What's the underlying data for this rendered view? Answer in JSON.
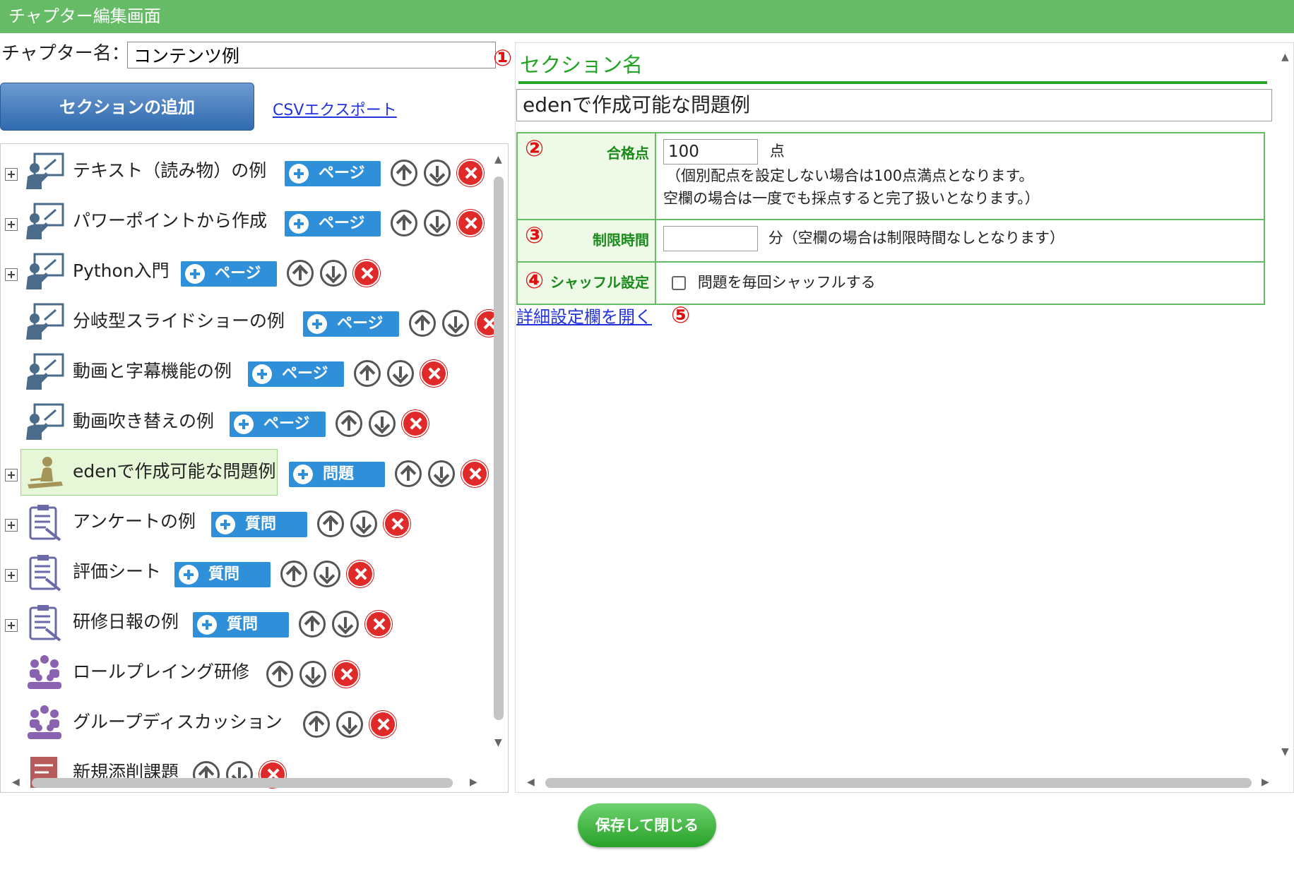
{
  "window": {
    "title": "チャプター編集画面"
  },
  "chapter": {
    "label": "チャプター名：",
    "name_value": "コンテンツ例"
  },
  "toolbar": {
    "add_section": "セクションの追加",
    "csv_export": "CSVエクスポート"
  },
  "tree": {
    "items": [
      {
        "label": "テキスト（読み物）の例",
        "icon": "presenter-icon",
        "expand": true,
        "add": "ページ"
      },
      {
        "label": "パワーポイントから作成",
        "icon": "presenter-icon",
        "expand": true,
        "add": "ページ"
      },
      {
        "label": "Python入門",
        "icon": "presenter-icon",
        "expand": true,
        "add": "ページ"
      },
      {
        "label": "分岐型スライドショーの例",
        "icon": "presenter-icon",
        "expand": false,
        "add": "ページ"
      },
      {
        "label": "動画と字幕機能の例",
        "icon": "presenter-icon",
        "expand": false,
        "add": "ページ"
      },
      {
        "label": "動画吹き替えの例",
        "icon": "presenter-icon",
        "expand": false,
        "add": "ページ"
      },
      {
        "label": "edenで作成可能な問題例",
        "icon": "test-taker-icon",
        "expand": true,
        "add": "問題",
        "selected": true
      },
      {
        "label": "アンケートの例",
        "icon": "clipboard-icon",
        "expand": true,
        "add": "質問"
      },
      {
        "label": "評価シート",
        "icon": "clipboard-icon",
        "expand": true,
        "add": "質問"
      },
      {
        "label": "研修日報の例",
        "icon": "clipboard-icon",
        "expand": true,
        "add": "質問"
      },
      {
        "label": "ロールプレイング研修",
        "icon": "group-icon",
        "expand": false
      },
      {
        "label": "グループディスカッション",
        "icon": "group-icon",
        "expand": false
      },
      {
        "label": "新規添削課題",
        "icon": "assignment-icon",
        "expand": false
      }
    ]
  },
  "section": {
    "heading": "セクション名",
    "name_value": "edenで作成可能な問題例",
    "pass_score": {
      "label": "合格点",
      "value": "100",
      "unit": "点",
      "note1": "（個別配点を設定しない場合は100点満点となります。",
      "note2": "空欄の場合は一度でも採点すると完了扱いとなります。）"
    },
    "time_limit": {
      "label": "制限時間",
      "value": "",
      "note": "分（空欄の場合は制限時間なしとなります）"
    },
    "shuffle": {
      "label": "シャッフル設定",
      "checkbox_label": "問題を毎回シャッフルする",
      "checked": false
    },
    "detail_link": "詳細設定欄を開く"
  },
  "markers": {
    "m1": "①",
    "m2": "②",
    "m3": "③",
    "m4": "④",
    "m5": "⑤"
  },
  "footer": {
    "save_close": "保存して閉じる"
  },
  "colors": {
    "header_green": "#66bb66",
    "add_blue": "#2f8fd8",
    "delete_red": "#e02a2a",
    "heading_green": "#22a422"
  }
}
